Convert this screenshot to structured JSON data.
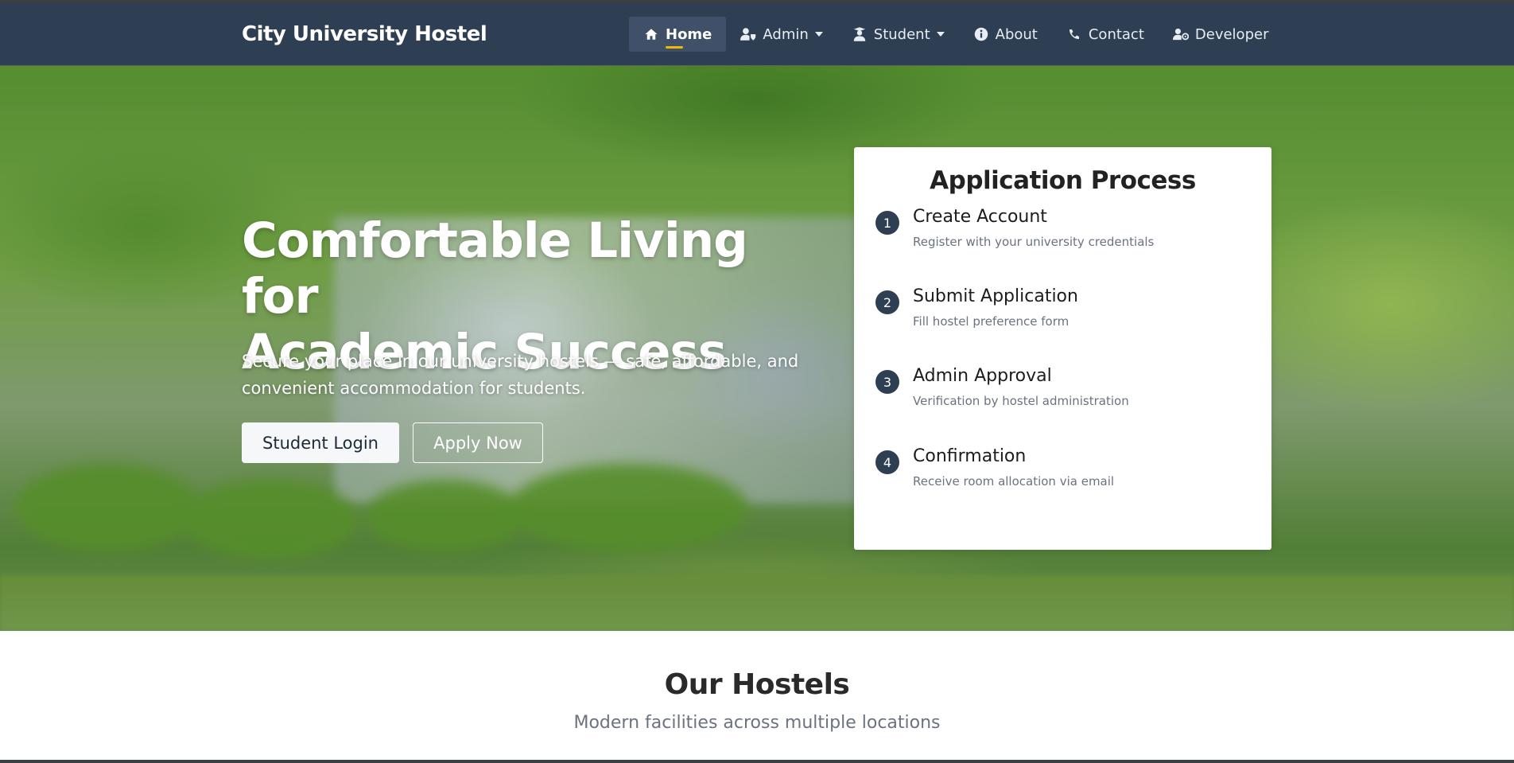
{
  "brand": "City University Hostel",
  "nav": {
    "home": "Home",
    "admin": "Admin",
    "student": "Student",
    "about": "About",
    "contact": "Contact",
    "developer": "Developer"
  },
  "icons": {
    "home": "home-icon",
    "admin": "user-shield-icon",
    "student": "student-icon",
    "about": "info-icon",
    "contact": "phone-icon",
    "developer": "user-gear-icon"
  },
  "colors": {
    "navbar": "#2e3e53",
    "active_underline": "#f2b705",
    "step_badge": "#2e3e53"
  },
  "hero": {
    "title_line1": "Comfortable Living for",
    "title_line2": "Academic Success",
    "subtitle_line1": "Secure your place in our university hostels — safe, affordable, and",
    "subtitle_line2": "convenient accommodation for students.",
    "login_button": "Student Login",
    "apply_button": "Apply Now"
  },
  "process": {
    "title": "Application Process",
    "steps": [
      {
        "num": "1",
        "title": "Create Account",
        "desc": "Register with your university credentials"
      },
      {
        "num": "2",
        "title": "Submit Application",
        "desc": "Fill hostel preference form"
      },
      {
        "num": "3",
        "title": "Admin Approval",
        "desc": "Verification by hostel administration"
      },
      {
        "num": "4",
        "title": "Confirmation",
        "desc": "Receive room allocation via email"
      }
    ]
  },
  "hostels": {
    "title": "Our Hostels",
    "subtitle": "Modern facilities across multiple locations"
  }
}
